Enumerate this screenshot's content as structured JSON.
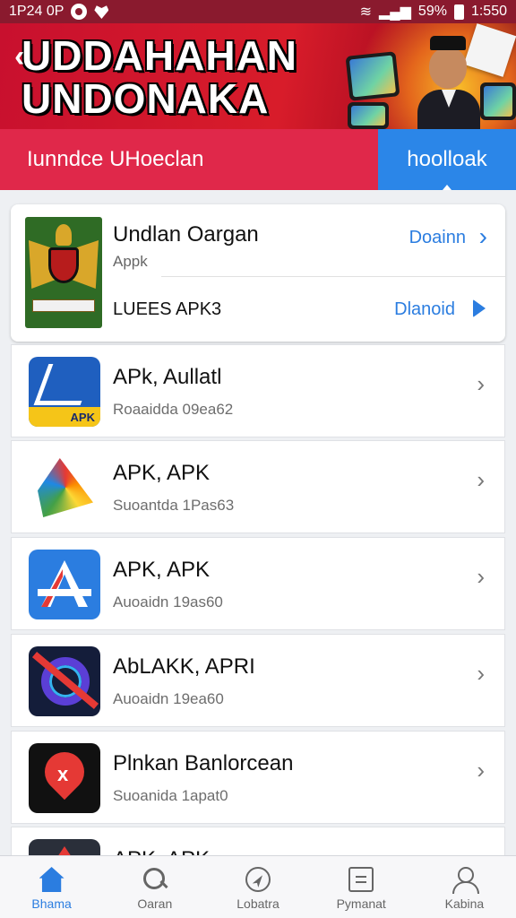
{
  "status_bar": {
    "time": "1P24 0P",
    "battery": "59%",
    "clock": "1:550"
  },
  "banner": {
    "back_label": "‹",
    "title_line1": "UDDAHAHAN",
    "title_line2": "UNDONAKA"
  },
  "tabs": {
    "primary": "Iunndce UHoeclan",
    "secondary": "hoolloak"
  },
  "featured": {
    "title": "Undlan Oargan",
    "subtitle": "Appk",
    "label2": "LUEES APK3",
    "link1": "Doainn",
    "link2": "Dlanoid"
  },
  "apps": [
    {
      "title": "APk, Aullatl",
      "subtitle": "Roaaidda 09ea62",
      "icon": "apk-arrow-icon"
    },
    {
      "title": "APK, APK",
      "subtitle": "Suoantda 1Pas63",
      "icon": "colorful-triangle-icon"
    },
    {
      "title": "APK, APK",
      "subtitle": "Auoaidn 19as60",
      "icon": "app-store-a-icon"
    },
    {
      "title": "AbLAKK, APRI",
      "subtitle": "Auoaidn 19ea60",
      "icon": "blocked-ring-icon"
    },
    {
      "title": "Plnkan Banlorcean",
      "subtitle": "Suoanida 1apat0",
      "icon": "red-pin-icon"
    },
    {
      "title": "APK, APK",
      "subtitle": "",
      "icon": "red-triangle-icon"
    }
  ],
  "nav": [
    {
      "label": "Bhama",
      "icon": "home-icon"
    },
    {
      "label": "Oaran",
      "icon": "search-icon"
    },
    {
      "label": "Lobatra",
      "icon": "compass-icon"
    },
    {
      "label": "Pymanat",
      "icon": "document-icon"
    },
    {
      "label": "Kabina",
      "icon": "person-icon"
    }
  ],
  "colors": {
    "brand_red": "#e0284a",
    "accent_blue": "#2b86e8",
    "status_bar": "#8a1a2e"
  }
}
